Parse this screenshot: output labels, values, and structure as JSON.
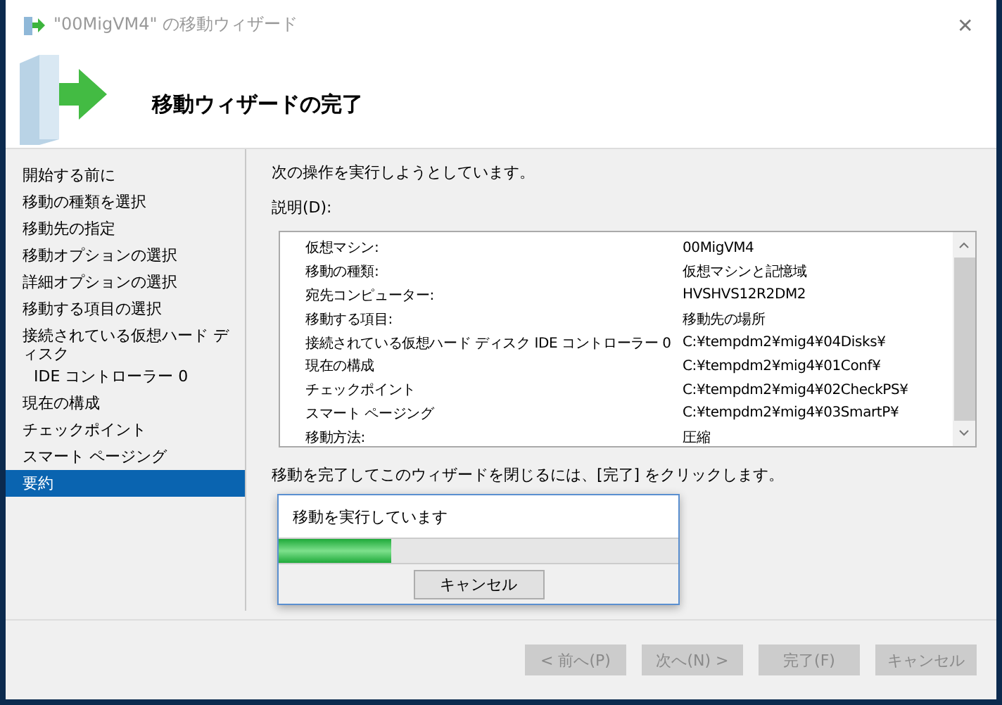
{
  "window": {
    "title": "\"00MigVM4\" の移動ウィザード",
    "close": "✕"
  },
  "header": {
    "title": "移動ウィザードの完了"
  },
  "sidebar": {
    "items": [
      {
        "label": "開始する前に",
        "selected": false
      },
      {
        "label": "移動の種類を選択",
        "selected": false
      },
      {
        "label": "移動先の指定",
        "selected": false
      },
      {
        "label": "移動オプションの選択",
        "selected": false
      },
      {
        "label": "詳細オプションの選択",
        "selected": false
      },
      {
        "label": "移動する項目の選択",
        "selected": false
      },
      {
        "label": "接続されている仮想ハード ディスク",
        "selected": false,
        "children": [
          {
            "label": "IDE コントローラー 0",
            "selected": false
          }
        ]
      },
      {
        "label": "現在の構成",
        "selected": false
      },
      {
        "label": "チェックポイント",
        "selected": false
      },
      {
        "label": "スマート ページング",
        "selected": false
      },
      {
        "label": "要約",
        "selected": true
      }
    ]
  },
  "content": {
    "intro": "次の操作を実行しようとしています。",
    "description_label": "説明(D):",
    "rows": [
      {
        "name": "仮想マシン:",
        "value": "00MigVM4"
      },
      {
        "name": "移動の種類:",
        "value": "仮想マシンと記憶域"
      },
      {
        "name": "宛先コンピューター:",
        "value": "HVSHVS12R2DM2"
      },
      {
        "name": "移動する項目:",
        "value": "移動先の場所"
      },
      {
        "name": "接続されている仮想ハード ディスク IDE コントローラー 0",
        "value": "C:¥tempdm2¥mig4¥04Disks¥"
      },
      {
        "name": "現在の構成",
        "value": "C:¥tempdm2¥mig4¥01Conf¥"
      },
      {
        "name": "チェックポイント",
        "value": "C:¥tempdm2¥mig4¥02CheckPS¥"
      },
      {
        "name": "スマート ページング",
        "value": "C:¥tempdm2¥mig4¥03SmartP¥"
      },
      {
        "name": "移動方法:",
        "value": "圧縮"
      }
    ],
    "finish_hint": "移動を完了してこのウィザードを閉じるには、[完了] をクリックします。"
  },
  "progress_dialog": {
    "message": "移動を実行しています",
    "level": 0.28,
    "cancel": "キャンセル"
  },
  "buttons": [
    {
      "label": "< 前へ(P)",
      "disabled": true
    },
    {
      "label": "次へ(N) >",
      "disabled": true
    },
    {
      "label": "完了(F)",
      "disabled": true
    },
    {
      "label": "キャンセル",
      "disabled": true
    }
  ]
}
